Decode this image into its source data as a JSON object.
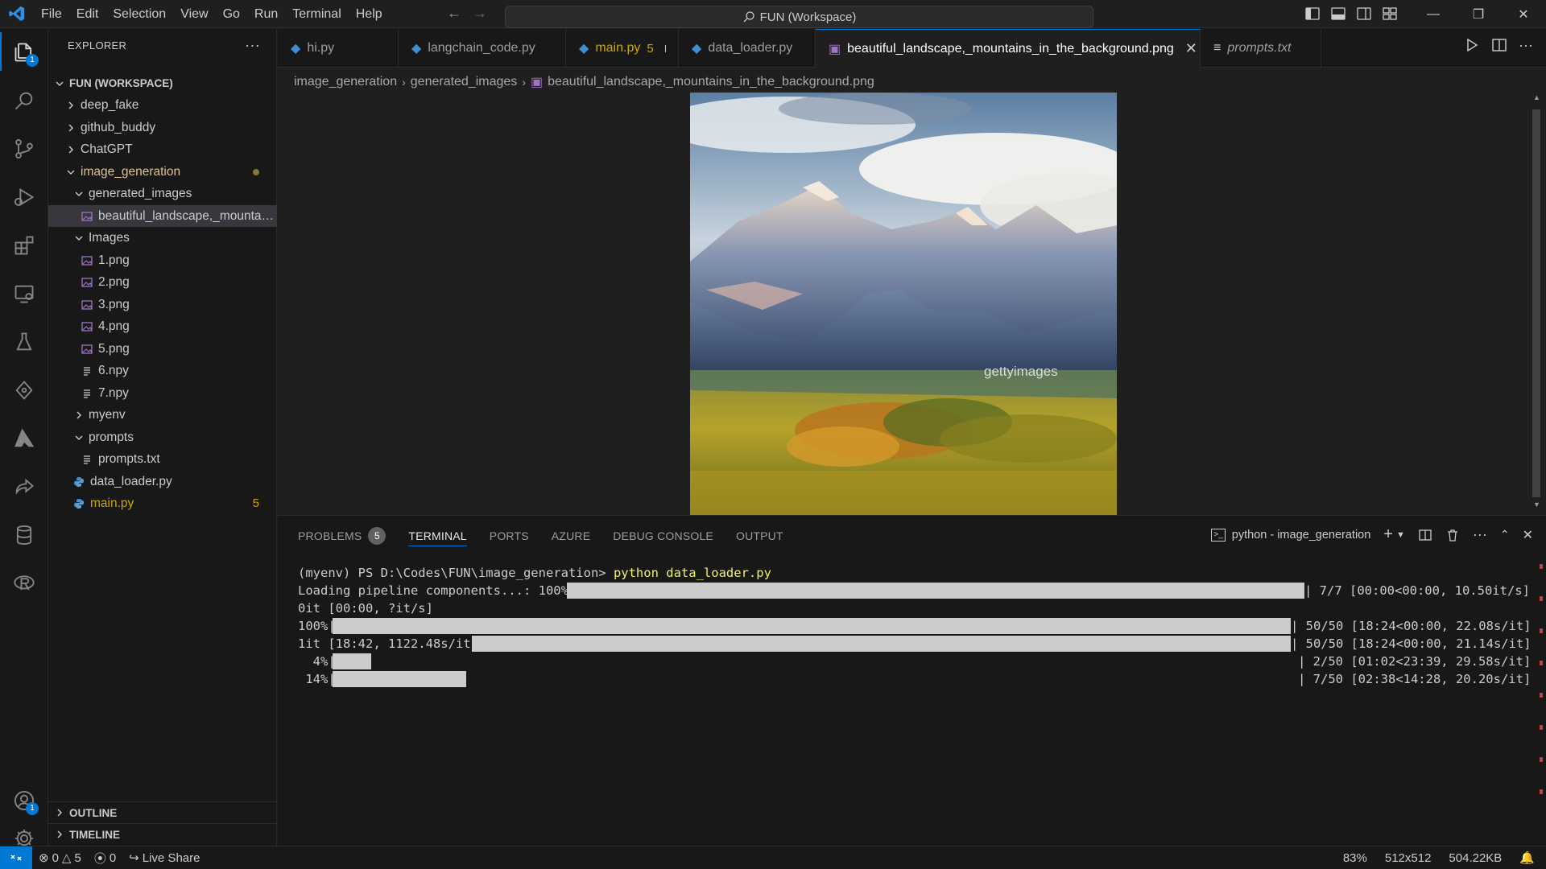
{
  "menu": [
    "File",
    "Edit",
    "Selection",
    "View",
    "Go",
    "Run",
    "Terminal",
    "Help"
  ],
  "command_center": "FUN (Workspace)",
  "activity": {
    "explorer_badge": "1",
    "accounts_badge": "1"
  },
  "sidebar": {
    "title": "EXPLORER",
    "workspace": "FUN (WORKSPACE)",
    "items": [
      {
        "label": "deep_fake"
      },
      {
        "label": "github_buddy"
      },
      {
        "label": "ChatGPT"
      },
      {
        "label": "image_generation"
      },
      {
        "label": "generated_images"
      },
      {
        "label": "beautiful_landscape,_mountains_in_the_background.png"
      },
      {
        "label": "Images"
      },
      {
        "label": "1.png"
      },
      {
        "label": "2.png"
      },
      {
        "label": "3.png"
      },
      {
        "label": "4.png"
      },
      {
        "label": "5.png"
      },
      {
        "label": "6.npy"
      },
      {
        "label": "7.npy"
      },
      {
        "label": "myenv"
      },
      {
        "label": "prompts"
      },
      {
        "label": "prompts.txt"
      },
      {
        "label": "data_loader.py"
      },
      {
        "label": "main.py",
        "count": "5"
      }
    ],
    "outline": "OUTLINE",
    "timeline": "TIMELINE"
  },
  "tabs": [
    {
      "label": "hi.py"
    },
    {
      "label": "langchain_code.py"
    },
    {
      "label": "main.py",
      "count": "5"
    },
    {
      "label": "data_loader.py"
    },
    {
      "label": "beautiful_landscape,_mountains_in_the_background.png"
    },
    {
      "label": "prompts.txt"
    }
  ],
  "breadcrumb": [
    "image_generation",
    "generated_images",
    "beautiful_landscape,_mountains_in_the_background.png"
  ],
  "image_watermark": "gettyimages",
  "panel": {
    "tabs": [
      "PROBLEMS",
      "TERMINAL",
      "PORTS",
      "AZURE",
      "DEBUG CONSOLE",
      "OUTPUT"
    ],
    "problems_count": "5",
    "terminal_name": "python - image_generation"
  },
  "terminal": {
    "prompt": "(myenv) PS D:\\Codes\\FUN\\image_generation> ",
    "command": "python data_loader.py",
    "lines": [
      {
        "left": "Loading pipeline components...: 100%|",
        "right": "| 7/7 [00:00<00:00, 10.50it/s]",
        "progress": 1.0
      },
      {
        "left": "0it [00:00, ?it/s]",
        "right": "",
        "progress": 0
      },
      {
        "left": "100%|",
        "right": "| 50/50 [18:24<00:00, 22.08s/it]",
        "progress": 1.0
      },
      {
        "left": "1it [18:42, 1122.48s/it]",
        "right": "| 50/50 [18:24<00:00, 21.14s/it]",
        "progress": 1.0
      },
      {
        "left": "  4%|",
        "right": "| 2/50 [01:02<23:39, 29.58s/it]",
        "progress": 0.04
      },
      {
        "left": " 14%|",
        "right": "| 7/50 [02:38<14:28, 20.20s/it]",
        "progress": 0.14
      }
    ]
  },
  "status": {
    "errors": "0",
    "warnings": "5",
    "ports": "0",
    "live_share": "Live Share",
    "zoom": "83%",
    "dimensions": "512x512",
    "file_size": "504.22KB"
  },
  "colors": {
    "accent": "#0078d4",
    "modified": "#cca700",
    "terminal_bar": "#cccccc"
  }
}
